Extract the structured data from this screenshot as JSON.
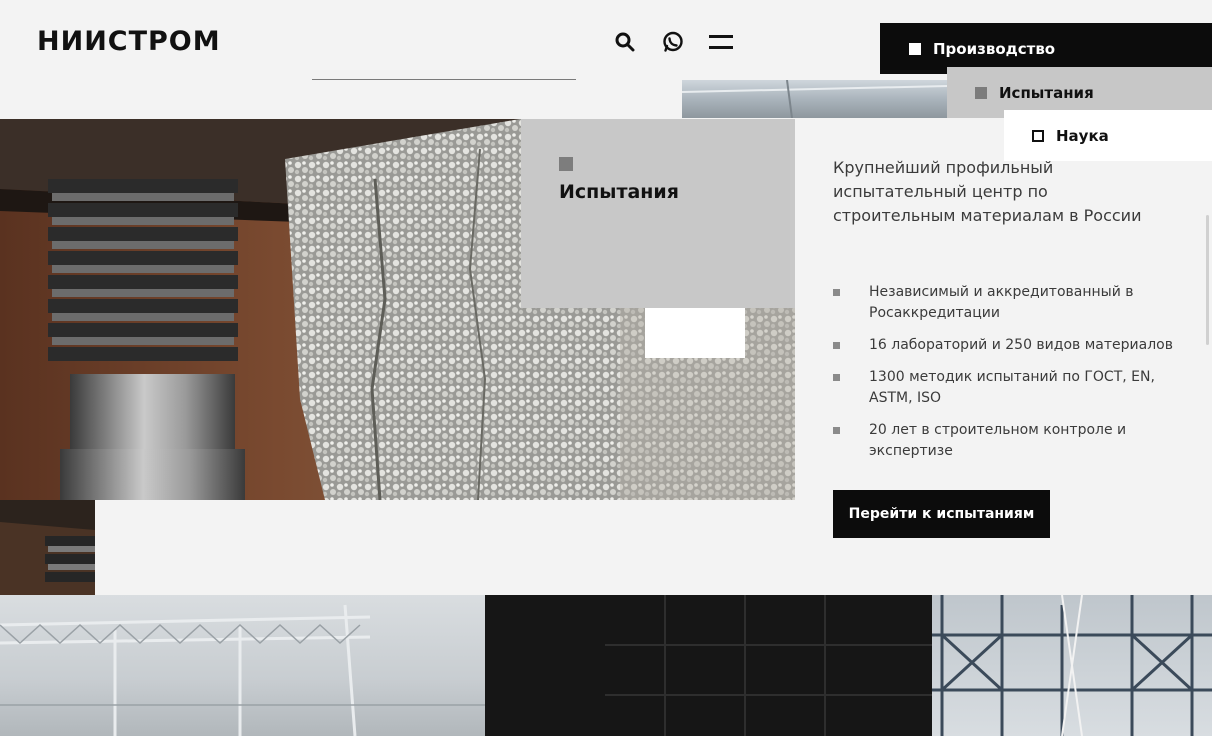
{
  "header": {
    "logo": "НИИСТРОМ",
    "icons": [
      "search-icon",
      "whatsapp-icon",
      "menu-icon"
    ]
  },
  "nav_tabs": [
    {
      "label": "Производство",
      "color": "#0c0c0c"
    },
    {
      "label": "Испытания",
      "color": "#c7c7c7"
    },
    {
      "label": "Наука",
      "color": "#ffffff"
    }
  ],
  "card": {
    "title": "Испытания"
  },
  "main": {
    "description": "Крупнейший профильный испытательный центр по строительным материалам в России",
    "features": [
      "Независимый и аккредитованный в Росаккредитации",
      "16 лабораторий и 250 видов материалов",
      "1300 методик испытаний по ГОСТ, EN, ASTM, ISO",
      "20 лет в строительном контроле и экспертизе"
    ],
    "cta_label": "Перейти к испытаниям"
  }
}
